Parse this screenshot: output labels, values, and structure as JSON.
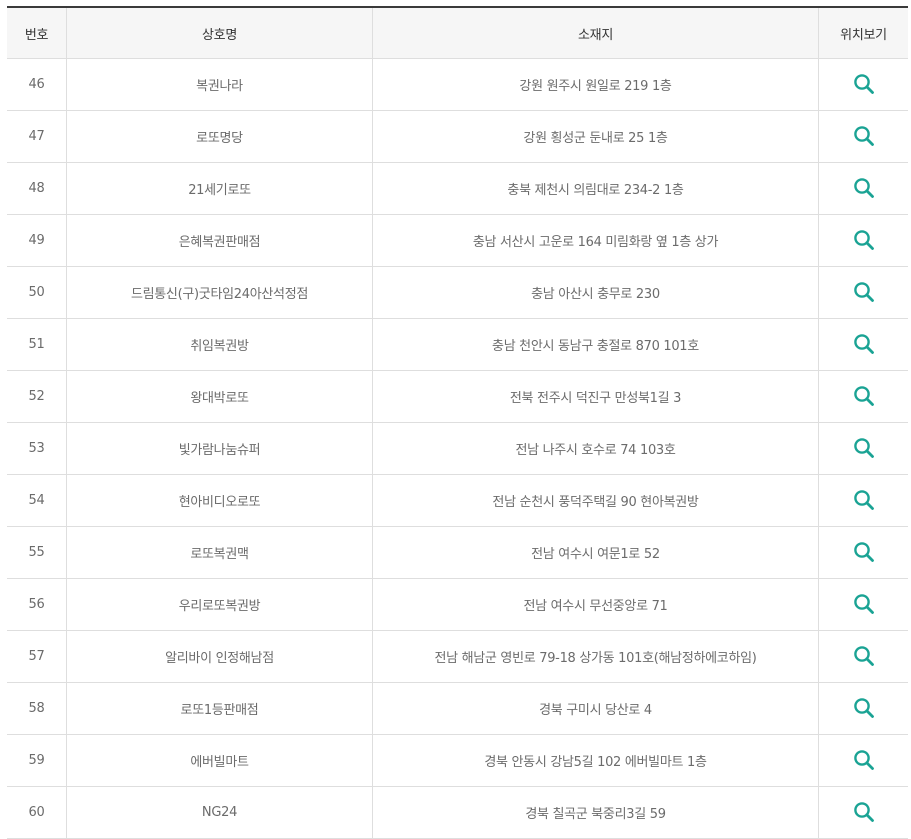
{
  "table": {
    "headers": {
      "no": "번호",
      "name": "상호명",
      "address": "소재지",
      "map": "위치보기"
    },
    "map_icon": "search-icon",
    "accent_color": "#1aa394",
    "rows": [
      {
        "no": "46",
        "name": "복권나라",
        "address": "강원 원주시 원일로 219 1층"
      },
      {
        "no": "47",
        "name": "로또명당",
        "address": "강원 횡성군 둔내로 25 1층"
      },
      {
        "no": "48",
        "name": "21세기로또",
        "address": "충북 제천시 의림대로 234-2 1층"
      },
      {
        "no": "49",
        "name": "은혜복권판매점",
        "address": "충남 서산시 고운로 164 미림화랑 옆 1층 상가"
      },
      {
        "no": "50",
        "name": "드림통신(구)굿타임24아산석정점",
        "address": "충남 아산시 충무로 230"
      },
      {
        "no": "51",
        "name": "취임복권방",
        "address": "충남 천안시 동남구 충절로 870 101호"
      },
      {
        "no": "52",
        "name": "왕대박로또",
        "address": "전북 전주시 덕진구 만성북1길 3"
      },
      {
        "no": "53",
        "name": "빛가람나눔슈퍼",
        "address": "전남 나주시 호수로 74 103호"
      },
      {
        "no": "54",
        "name": "현아비디오로또",
        "address": "전남 순천시 풍덕주택길 90 현아복권방"
      },
      {
        "no": "55",
        "name": "로또복권맥",
        "address": "전남 여수시 여문1로 52"
      },
      {
        "no": "56",
        "name": "우리로또복권방",
        "address": "전남 여수시 무선중앙로 71"
      },
      {
        "no": "57",
        "name": "알리바이 인정해남점",
        "address": "전남 해남군 영빈로 79-18 상가동 101호(해남정하에코하임)"
      },
      {
        "no": "58",
        "name": "로또1등판매점",
        "address": "경북 구미시 당산로 4"
      },
      {
        "no": "59",
        "name": "에버빌마트",
        "address": "경북 안동시 강남5길 102 에버빌마트 1층"
      },
      {
        "no": "60",
        "name": "NG24",
        "address": "경북 칠곡군 북중리3길 59"
      }
    ]
  }
}
